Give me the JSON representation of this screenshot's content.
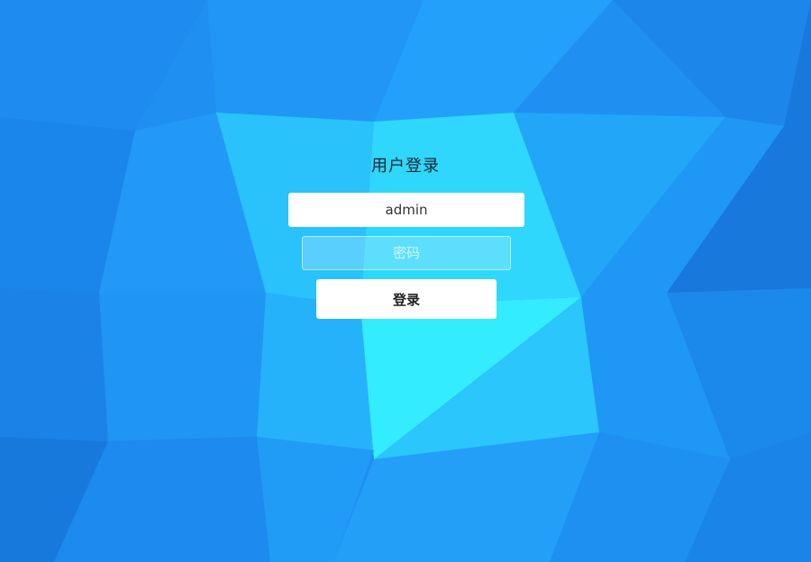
{
  "login": {
    "title": "用户登录",
    "username_value": "admin",
    "password_placeholder": "密码",
    "submit_label": "登录"
  },
  "colors": {
    "background": "#1f8ff2",
    "highlight": "#33ecfd",
    "field_bg": "#ffffff",
    "title_text": "#1a2430"
  }
}
